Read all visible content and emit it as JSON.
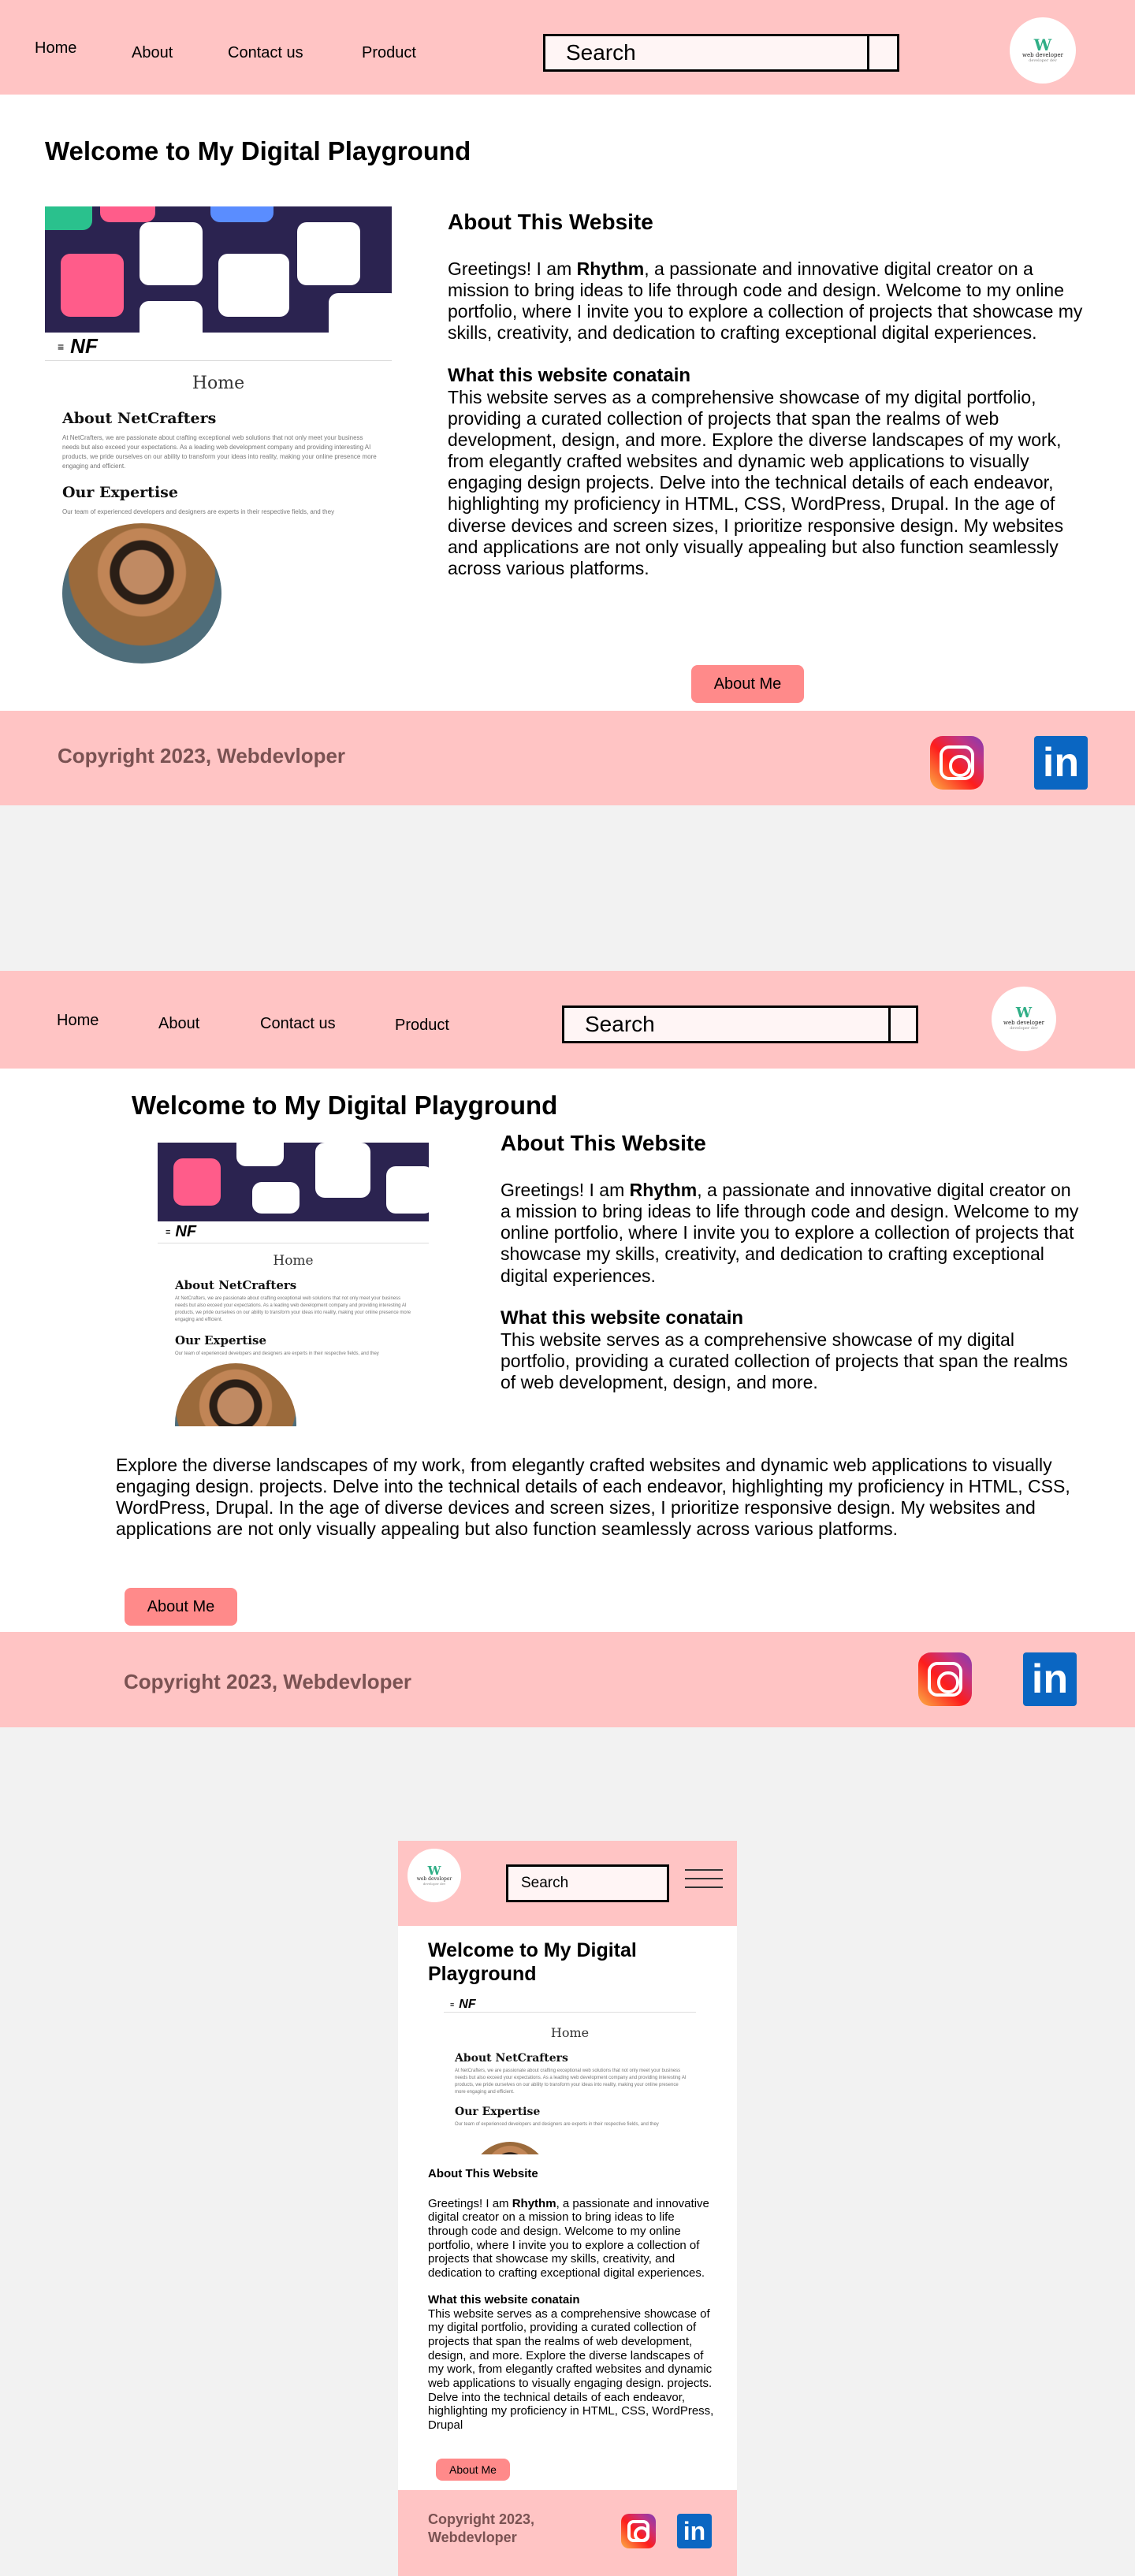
{
  "nav": {
    "home": "Home",
    "about": "About",
    "contact": "Contact us",
    "product": "Product",
    "search_label": "Search"
  },
  "logo": {
    "mark": "W",
    "name": "web developer",
    "tagline": "developer dev"
  },
  "hero": {
    "title": "Welcome to My Digital Playground"
  },
  "mock_image": {
    "menu": "≡",
    "brand": "NF",
    "home": "Home",
    "about_heading": "About NetCrafters",
    "about_text": "At NetCrafters, we are passionate about crafting exceptional web solutions that not only meet your business needs but also exceed your expectations. As a leading web development company and providing interesting AI products, we pride ourselves on our ability to transform your ideas into reality, making your online presence more engaging and efficient.",
    "expertise_heading": "Our Expertise",
    "expertise_text": "Our team of experienced developers and designers are experts in their respective fields, and they"
  },
  "about": {
    "heading": "About This Website",
    "intro_before": "Greetings! I am ",
    "name": "Rhythm",
    "intro_after": ", a passionate and innovative digital creator on a mission to bring ideas to life through code and design. Welcome to my online portfolio, where I invite you to explore a collection of projects that showcase my skills, creativity, and dedication to crafting exceptional digital experiences.",
    "contain_heading": "What this website conatain",
    "contain_text_full": "This website serves as a comprehensive showcase of my digital portfolio, providing a curated collection of projects that span the realms of web development, design, and more. Explore the diverse landscapes of my work, from elegantly crafted websites and dynamic web applications to visually engaging design projects. Delve into the technical details of each endeavor, highlighting my proficiency in HTML, CSS, WordPress, Drupal. In the age of diverse devices and screen sizes, I prioritize responsive design. My websites and applications are not only visually appealing but also function seamlessly across various platforms.",
    "contain_text_part1": "This website serves as a comprehensive showcase of my digital portfolio, providing a curated collection of projects that span the realms of web development, design, and more.",
    "contain_text_part2": " Explore the diverse landscapes of my work, from elegantly crafted websites and dynamic web applications to visually engaging design.  projects. Delve into the technical details of each endeavor, highlighting my proficiency in HTML, CSS, WordPress, Drupal. In the age of diverse devices and screen sizes, I prioritize responsive design. My websites and applications are not only visually appealing but also function seamlessly across various platforms.",
    "contain_text_mobile": "This website serves as a comprehensive showcase of my digital portfolio, providing a curated collection of projects that span the realms of web development, design, and more.  Explore the diverse landscapes of my work, from elegantly crafted websites and dynamic web applications to visually engaging design.  projects. Delve into the technical details of each endeavor, highlighting my proficiency in HTML, CSS, WordPress, Drupal",
    "button": "About Me"
  },
  "footer": {
    "copyright": "Copyright 2023, Webdevloper",
    "linkedin": "in"
  },
  "icons": [
    "instagram-icon",
    "linkedin-icon",
    "menu-icon",
    "search-icon",
    "logo-icon"
  ],
  "colors": {
    "nav": "#ffc4c4",
    "button": "#ff8a8a",
    "footer_text": "#7a5252",
    "linkedin": "#0a66c2"
  }
}
